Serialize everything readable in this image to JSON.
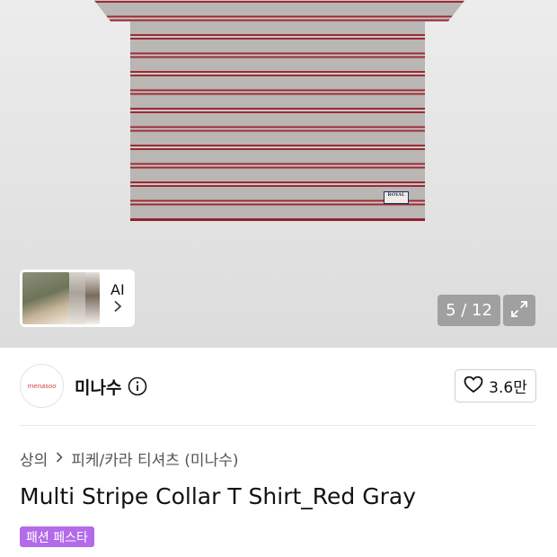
{
  "image_viewer": {
    "counter": "5 / 12",
    "ai_label": "AI",
    "tag_text": "ROYAL"
  },
  "brand": {
    "logo_text": "menasoo",
    "name": "미나수",
    "likes": "3.6만"
  },
  "breadcrumb": {
    "items": [
      "상의",
      "피케/카라 티셔츠 (미나수)"
    ]
  },
  "product": {
    "title": "Multi Stripe Collar T Shirt_Red Gray",
    "badge": "패션 페스타"
  },
  "colors": {
    "badge_bg": "#b36bea",
    "stripe_red": "#9a2b35",
    "stripe_gray": "#b9b6b4"
  },
  "icons": [
    "info-icon",
    "heart-icon",
    "expand-icon",
    "chevron-right-icon"
  ]
}
